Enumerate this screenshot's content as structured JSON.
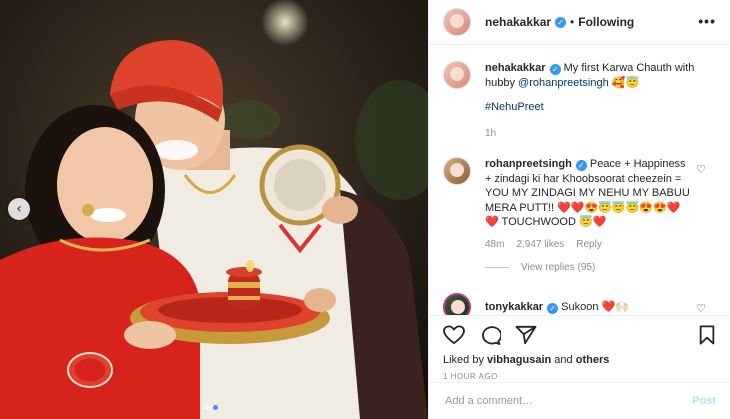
{
  "post": {
    "username": "nehakakkar",
    "follow_status": "Following",
    "more_label": "•••",
    "photo_nav_prev": "‹"
  },
  "comments": [
    {
      "username": "nehakakkar",
      "text": "My first Karwa Chauth with hubby",
      "mention": "@rohanpreetsingh",
      "emoji": "🥰😇",
      "hashtag": "#NehuPreet",
      "time": "1h"
    },
    {
      "username": "rohanpreetsingh",
      "text": "Peace + Happiness + zindagi ki har Khoobsoorat cheezein = YOU MY ZINDAGI MY NEHU MY BABUU MERA PUTT!! ❤️❤️😍😇😇😇😍😍❤️ ❤️ TOUCHWOOD 😇❤️",
      "time": "48m",
      "likes": "2,947 likes",
      "reply": "Reply",
      "view_replies": "View replies (95)"
    },
    {
      "username": "tonykakkar",
      "text": "Sukoon ❤️🙌🏻"
    }
  ],
  "actions": {
    "liked_by_prefix": "Liked by",
    "liked_by_user": "vibhagusain",
    "liked_by_and": "and",
    "liked_by_others": "others",
    "timestamp": "1 HOUR AGO"
  },
  "add_comment": {
    "placeholder": "Add a comment…",
    "post_label": "Post"
  },
  "colors": {
    "verified": "#3897f0",
    "post_button": "#b2dffc",
    "turban": "#e0432c",
    "dupatta": "#d8231c"
  }
}
